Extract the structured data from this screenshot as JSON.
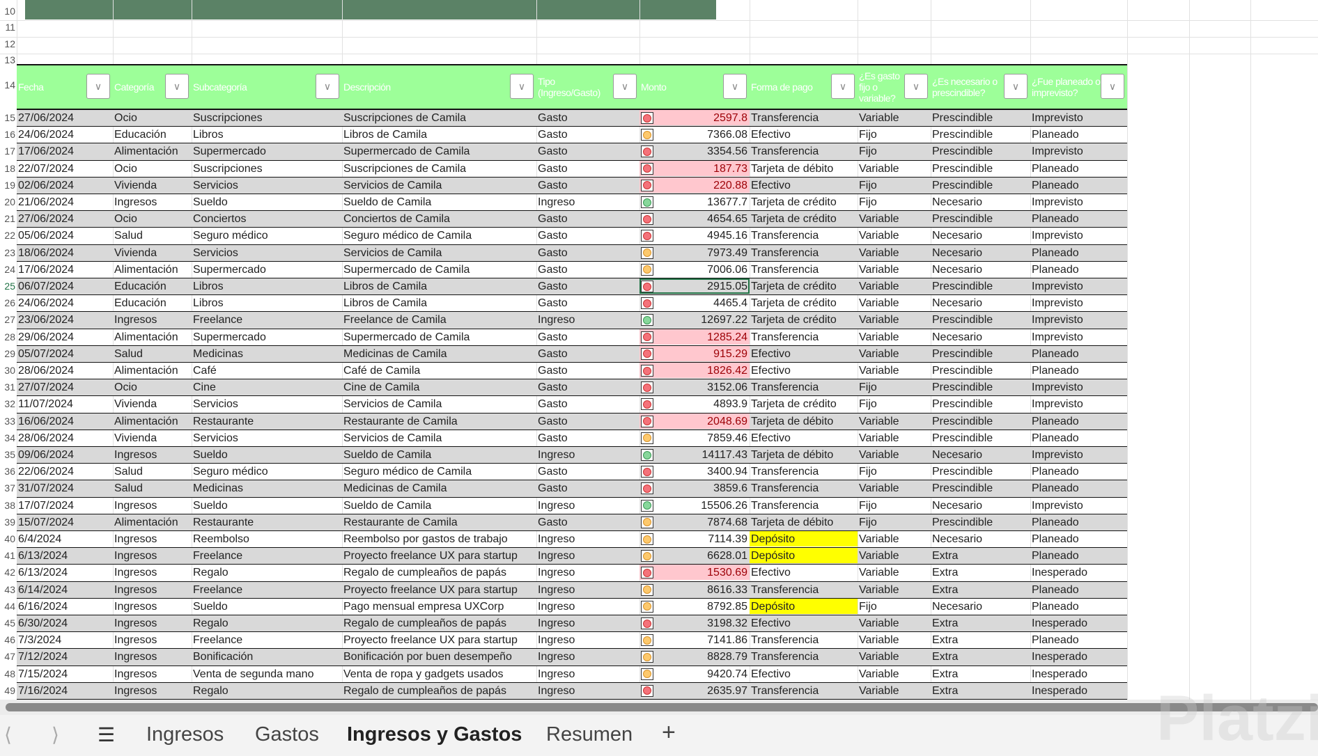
{
  "headers": [
    "Fecha",
    "Categoría",
    "Subcategoría",
    "Descripción",
    "Tipo (Ingreso/Gasto)",
    "Monto",
    "Forma de pago",
    "¿Es gasto fijo o variable?",
    "¿Es necesario o prescindible?",
    "¿Fue planeado o imprevisto?"
  ],
  "status_colors": {
    "red": "#f4727a",
    "yellow": "#fdc96d",
    "green": "#88d79b"
  },
  "rows": [
    [
      "15",
      "27/06/2024",
      "Ocio",
      "Suscripciones",
      "Suscripciones de Camila",
      "Gasto",
      "red",
      "2597.8",
      "Transferencia",
      "Variable",
      "Prescindible",
      "Imprevisto",
      true,
      false
    ],
    [
      "16",
      "24/06/2024",
      "Educación",
      "Libros",
      "Libros de Camila",
      "Gasto",
      "yellow",
      "7366.08",
      "Efectivo",
      "Fijo",
      "Prescindible",
      "Planeado",
      false,
      false
    ],
    [
      "17",
      "17/06/2024",
      "Alimentación",
      "Supermercado",
      "Supermercado de Camila",
      "Gasto",
      "red",
      "3354.56",
      "Transferencia",
      "Fijo",
      "Prescindible",
      "Imprevisto",
      false,
      false
    ],
    [
      "18",
      "22/07/2024",
      "Ocio",
      "Suscripciones",
      "Suscripciones de Camila",
      "Gasto",
      "red",
      "187.73",
      "Tarjeta de débito",
      "Variable",
      "Prescindible",
      "Planeado",
      true,
      false
    ],
    [
      "19",
      "02/06/2024",
      "Vivienda",
      "Servicios",
      "Servicios de Camila",
      "Gasto",
      "red",
      "220.88",
      "Efectivo",
      "Fijo",
      "Prescindible",
      "Planeado",
      true,
      false
    ],
    [
      "20",
      "21/06/2024",
      "Ingresos",
      "Sueldo",
      "Sueldo de Camila",
      "Ingreso",
      "green",
      "13677.7",
      "Tarjeta de crédito",
      "Fijo",
      "Necesario",
      "Imprevisto",
      false,
      false
    ],
    [
      "21",
      "27/06/2024",
      "Ocio",
      "Conciertos",
      "Conciertos de Camila",
      "Gasto",
      "red",
      "4654.65",
      "Tarjeta de crédito",
      "Variable",
      "Prescindible",
      "Planeado",
      false,
      false
    ],
    [
      "22",
      "05/06/2024",
      "Salud",
      "Seguro médico",
      "Seguro médico de Camila",
      "Gasto",
      "red",
      "4945.16",
      "Transferencia",
      "Variable",
      "Necesario",
      "Imprevisto",
      false,
      false
    ],
    [
      "23",
      "18/06/2024",
      "Vivienda",
      "Servicios",
      "Servicios de Camila",
      "Gasto",
      "yellow",
      "7973.49",
      "Transferencia",
      "Variable",
      "Necesario",
      "Planeado",
      false,
      false
    ],
    [
      "24",
      "17/06/2024",
      "Alimentación",
      "Supermercado",
      "Supermercado de Camila",
      "Gasto",
      "yellow",
      "7006.06",
      "Transferencia",
      "Variable",
      "Necesario",
      "Planeado",
      false,
      false
    ],
    [
      "25",
      "06/07/2024",
      "Educación",
      "Libros",
      "Libros de Camila",
      "Gasto",
      "red",
      "2915.05",
      "Tarjeta de crédito",
      "Variable",
      "Prescindible",
      "Imprevisto",
      false,
      false
    ],
    [
      "26",
      "24/06/2024",
      "Educación",
      "Libros",
      "Libros de Camila",
      "Gasto",
      "red",
      "4465.4",
      "Tarjeta de crédito",
      "Variable",
      "Necesario",
      "Imprevisto",
      false,
      false
    ],
    [
      "27",
      "23/06/2024",
      "Ingresos",
      "Freelance",
      "Freelance de Camila",
      "Ingreso",
      "green",
      "12697.22",
      "Tarjeta de crédito",
      "Variable",
      "Prescindible",
      "Imprevisto",
      false,
      false
    ],
    [
      "28",
      "29/06/2024",
      "Alimentación",
      "Supermercado",
      "Supermercado de Camila",
      "Gasto",
      "red",
      "1285.24",
      "Transferencia",
      "Variable",
      "Necesario",
      "Imprevisto",
      true,
      false
    ],
    [
      "29",
      "05/07/2024",
      "Salud",
      "Medicinas",
      "Medicinas de Camila",
      "Gasto",
      "red",
      "915.29",
      "Efectivo",
      "Variable",
      "Prescindible",
      "Planeado",
      true,
      false
    ],
    [
      "30",
      "28/06/2024",
      "Alimentación",
      "Café",
      "Café de Camila",
      "Gasto",
      "red",
      "1826.42",
      "Efectivo",
      "Variable",
      "Prescindible",
      "Planeado",
      true,
      false
    ],
    [
      "31",
      "27/07/2024",
      "Ocio",
      "Cine",
      "Cine de Camila",
      "Gasto",
      "red",
      "3152.06",
      "Transferencia",
      "Fijo",
      "Prescindible",
      "Imprevisto",
      false,
      false
    ],
    [
      "32",
      "11/07/2024",
      "Vivienda",
      "Servicios",
      "Servicios de Camila",
      "Gasto",
      "red",
      "4893.9",
      "Tarjeta de crédito",
      "Fijo",
      "Prescindible",
      "Imprevisto",
      false,
      false
    ],
    [
      "33",
      "16/06/2024",
      "Alimentación",
      "Restaurante",
      "Restaurante de Camila",
      "Gasto",
      "red",
      "2048.69",
      "Tarjeta de débito",
      "Variable",
      "Prescindible",
      "Planeado",
      true,
      false
    ],
    [
      "34",
      "28/06/2024",
      "Vivienda",
      "Servicios",
      "Servicios de Camila",
      "Gasto",
      "yellow",
      "7859.46",
      "Efectivo",
      "Variable",
      "Prescindible",
      "Planeado",
      false,
      false
    ],
    [
      "35",
      "09/06/2024",
      "Ingresos",
      "Sueldo",
      "Sueldo de Camila",
      "Ingreso",
      "green",
      "14117.43",
      "Tarjeta de débito",
      "Variable",
      "Necesario",
      "Imprevisto",
      false,
      false
    ],
    [
      "36",
      "22/06/2024",
      "Salud",
      "Seguro médico",
      "Seguro médico de Camila",
      "Gasto",
      "red",
      "3400.94",
      "Transferencia",
      "Fijo",
      "Prescindible",
      "Planeado",
      false,
      false
    ],
    [
      "37",
      "31/07/2024",
      "Salud",
      "Medicinas",
      "Medicinas de Camila",
      "Gasto",
      "red",
      "3859.6",
      "Transferencia",
      "Variable",
      "Prescindible",
      "Planeado",
      false,
      false
    ],
    [
      "38",
      "17/07/2024",
      "Ingresos",
      "Sueldo",
      "Sueldo de Camila",
      "Ingreso",
      "green",
      "15506.26",
      "Transferencia",
      "Fijo",
      "Necesario",
      "Imprevisto",
      false,
      false
    ],
    [
      "39",
      "15/07/2024",
      "Alimentación",
      "Restaurante",
      "Restaurante de Camila",
      "Gasto",
      "yellow",
      "7874.68",
      "Tarjeta de débito",
      "Fijo",
      "Prescindible",
      "Planeado",
      false,
      false
    ],
    [
      "40",
      "6/4/2024",
      "Ingresos",
      "Reembolso",
      "Reembolso por gastos de trabajo",
      "Ingreso",
      "yellow",
      "7114.39",
      "Depósito",
      "Variable",
      "Necesario",
      "Planeado",
      false,
      true
    ],
    [
      "41",
      "6/13/2024",
      "Ingresos",
      "Freelance",
      "Proyecto freelance UX para startup",
      "Ingreso",
      "yellow",
      "6628.01",
      "Depósito",
      "Variable",
      "Extra",
      "Planeado",
      false,
      true
    ],
    [
      "42",
      "6/13/2024",
      "Ingresos",
      "Regalo",
      "Regalo de cumpleaños de papás",
      "Ingreso",
      "red",
      "1530.69",
      "Efectivo",
      "Variable",
      "Extra",
      "Inesperado",
      true,
      false
    ],
    [
      "43",
      "6/14/2024",
      "Ingresos",
      "Freelance",
      "Proyecto freelance UX para startup",
      "Ingreso",
      "yellow",
      "8616.33",
      "Transferencia",
      "Variable",
      "Extra",
      "Planeado",
      false,
      false
    ],
    [
      "44",
      "6/16/2024",
      "Ingresos",
      "Sueldo",
      "Pago mensual empresa UXCorp",
      "Ingreso",
      "yellow",
      "8792.85",
      "Depósito",
      "Fijo",
      "Necesario",
      "Planeado",
      false,
      true
    ],
    [
      "45",
      "6/30/2024",
      "Ingresos",
      "Regalo",
      "Regalo de cumpleaños de papás",
      "Ingreso",
      "red",
      "3198.32",
      "Efectivo",
      "Variable",
      "Extra",
      "Inesperado",
      false,
      false
    ],
    [
      "46",
      "7/3/2024",
      "Ingresos",
      "Freelance",
      "Proyecto freelance UX para startup",
      "Ingreso",
      "yellow",
      "7141.86",
      "Transferencia",
      "Variable",
      "Extra",
      "Planeado",
      false,
      false
    ],
    [
      "47",
      "7/12/2024",
      "Ingresos",
      "Bonificación",
      "Bonificación por buen desempeño",
      "Ingreso",
      "yellow",
      "8828.79",
      "Transferencia",
      "Variable",
      "Extra",
      "Inesperado",
      false,
      false
    ],
    [
      "48",
      "7/15/2024",
      "Ingresos",
      "Venta de segunda mano",
      "Venta de ropa y gadgets usados",
      "Ingreso",
      "yellow",
      "9420.74",
      "Efectivo",
      "Variable",
      "Extra",
      "Inesperado",
      false,
      false
    ],
    [
      "49",
      "7/16/2024",
      "Ingresos",
      "Regalo",
      "Regalo de cumpleaños de papás",
      "Ingreso",
      "red",
      "2635.97",
      "Transferencia",
      "Variable",
      "Extra",
      "Inesperado",
      false,
      false
    ]
  ],
  "selected_row": "25",
  "upper_rows": [
    "10",
    "11",
    "12",
    "13"
  ],
  "header_row": "14",
  "tabs": [
    "Ingresos",
    "Gastos",
    "Ingresos y Gastos",
    "Resumen"
  ],
  "active_tab": "Ingresos y Gastos",
  "add_tab": "+",
  "watermark": "Platzi"
}
